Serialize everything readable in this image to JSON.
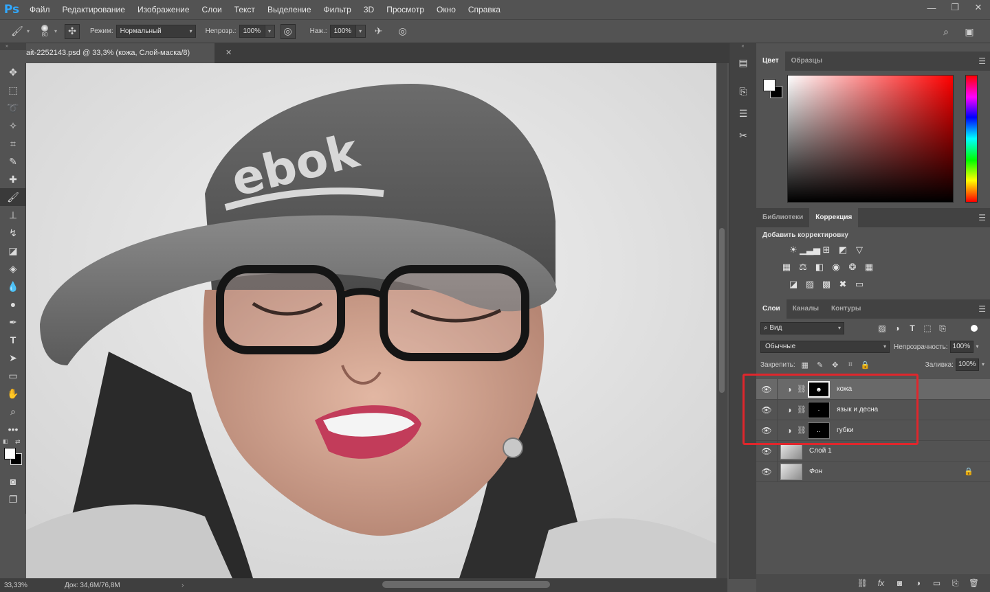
{
  "app": {
    "logo": "Ps"
  },
  "menu": [
    "Файл",
    "Редактирование",
    "Изображение",
    "Слои",
    "Текст",
    "Выделение",
    "Фильтр",
    "3D",
    "Просмотр",
    "Окно",
    "Справка"
  ],
  "window_controls": [
    "—",
    "❐",
    "✕"
  ],
  "options": {
    "brush_size": "80",
    "mode_label": "Режим:",
    "mode_value": "Нормальный",
    "opacity_label": "Непрозр.:",
    "opacity_value": "100%",
    "flow_label": "Наж.:",
    "flow_value": "100%"
  },
  "document": {
    "tab_title": "ait-2252143.psd @ 33,3% (кожа, Слой-маска/8)",
    "close": "✕",
    "zoom": "33,33%",
    "doc_size": "Док: 34,6M/76,8M"
  },
  "color_panel": {
    "tabs": [
      "Цвет",
      "Образцы"
    ],
    "fg_color": "#ffffff",
    "bg_color": "#000000"
  },
  "adjustments_panel": {
    "tabs": [
      "Библиотеки",
      "Коррекция"
    ],
    "title": "Добавить корректировку"
  },
  "layers_panel": {
    "tabs": [
      "Слои",
      "Каналы",
      "Контуры"
    ],
    "filter_kind": "Вид",
    "blend_mode": "Обычные",
    "opacity_label": "Непрозрачность:",
    "opacity_value": "100%",
    "lock_label": "Закрепить:",
    "fill_label": "Заливка:",
    "fill_value": "100%",
    "layers": [
      {
        "name": "кожа",
        "type": "adjustment",
        "selected": true
      },
      {
        "name": "язык и десна",
        "type": "adjustment",
        "selected": false
      },
      {
        "name": "губки",
        "type": "adjustment",
        "selected": false
      },
      {
        "name": "Слой 1",
        "type": "image",
        "selected": false
      },
      {
        "name": "Фон",
        "type": "image",
        "selected": false,
        "locked": true
      }
    ]
  },
  "highlight_color": "#e0262c"
}
